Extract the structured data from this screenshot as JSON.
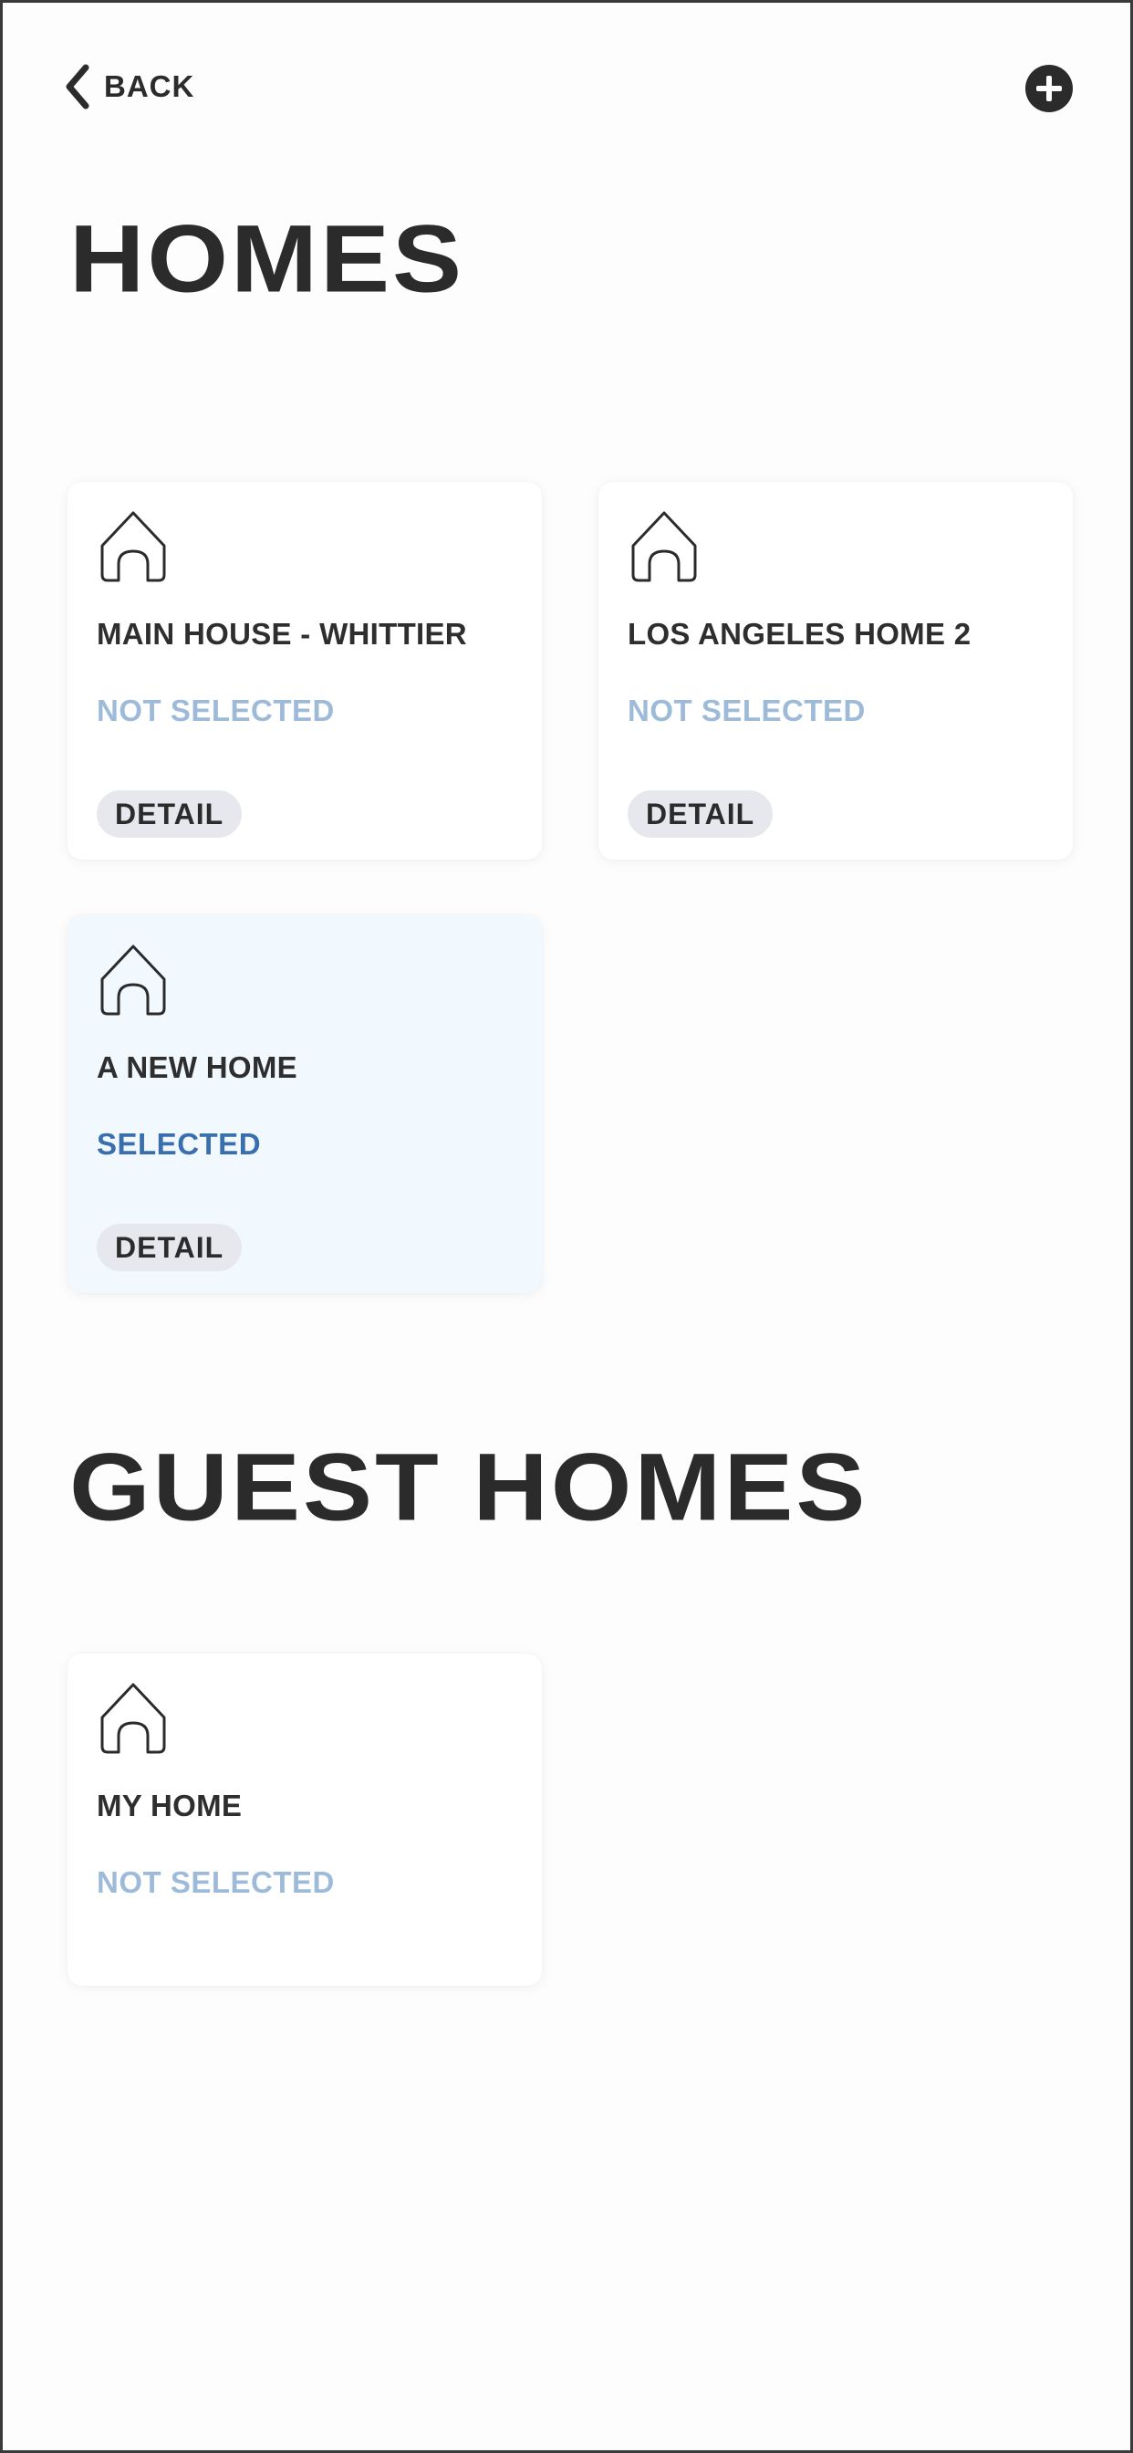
{
  "header": {
    "back_label": "BACK",
    "back_icon": "chevron-left-icon",
    "add_icon": "plus-circle-icon"
  },
  "homes": {
    "title": "HOMES",
    "items": [
      {
        "name": "MAIN HOUSE - WHITTIER",
        "status": "NOT SELECTED",
        "selected": false,
        "detail_label": "DETAIL",
        "icon": "house-icon"
      },
      {
        "name": "LOS ANGELES HOME 2",
        "status": "NOT SELECTED",
        "selected": false,
        "detail_label": "DETAIL",
        "icon": "house-icon"
      },
      {
        "name": "A NEW HOME",
        "status": "SELECTED",
        "selected": true,
        "detail_label": "DETAIL",
        "icon": "house-icon"
      }
    ]
  },
  "guest_homes": {
    "title": "GUEST HOMES",
    "items": [
      {
        "name": "MY HOME",
        "status": "NOT SELECTED",
        "selected": false,
        "icon": "house-icon"
      }
    ]
  },
  "colors": {
    "text": "#2b2b2b",
    "status_inactive": "#9dbbd9",
    "status_active": "#3a6fae",
    "selected_card_bg": "#f1f8fe",
    "pill_bg": "#e6e8ee"
  }
}
